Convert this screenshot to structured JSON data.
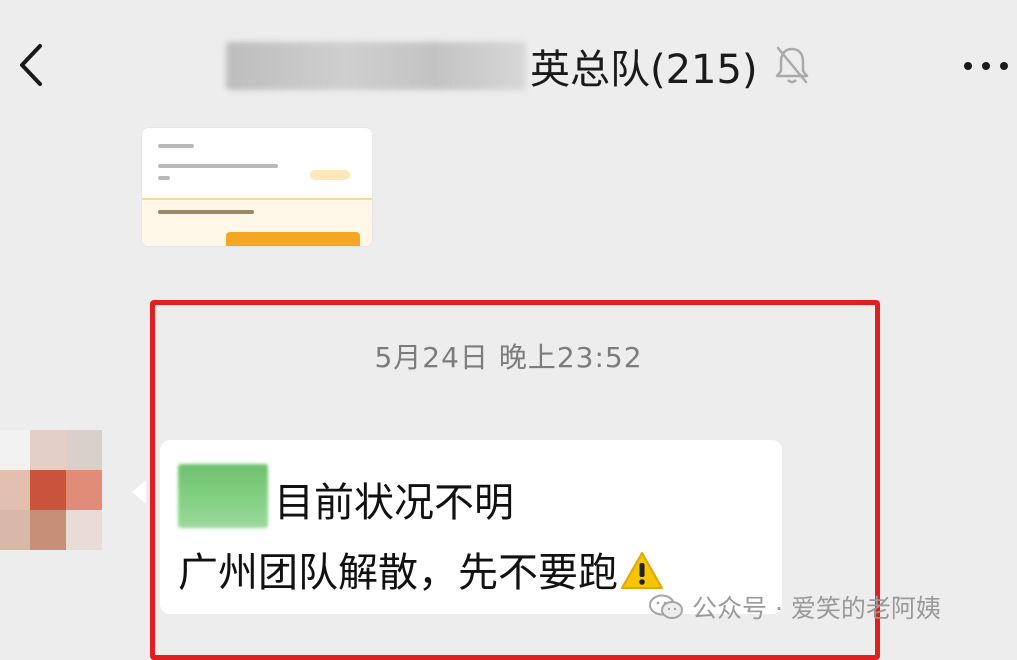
{
  "header": {
    "title_suffix": "英总队(215)",
    "icons": [
      "chevron-left-icon",
      "bell-muted-icon",
      "more-icon"
    ]
  },
  "chat": {
    "timestamp": "5月24日 晚上23:52",
    "message": {
      "line1": "目前状况不明",
      "line2": "广州团队解散，先不要跑",
      "emoji": "warning-icon"
    }
  },
  "watermark": {
    "text": "公众号 · 爱笑的老阿姨"
  },
  "colors": {
    "background": "#ededed",
    "bubble": "#ffffff",
    "highlight_border": "#e02020",
    "timestamp": "#7c7c7c"
  }
}
